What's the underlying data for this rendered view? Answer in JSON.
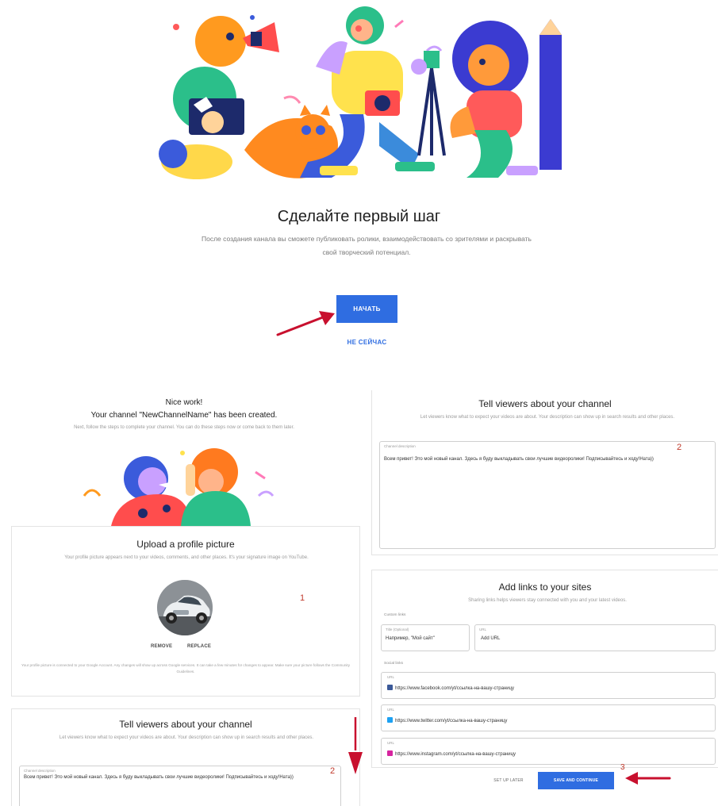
{
  "welcome": {
    "title": "Сделайте первый шаг",
    "description": "После создания канала вы сможете публиковать ролики, взаимодействовать со зрителями и раскрывать свой творческий потенциал.",
    "start_button": "НАЧАТЬ",
    "not_now_link": "НЕ СЕЙЧАС"
  },
  "created": {
    "line1": "Nice work!",
    "line2": "Your channel \"NewChannelName\" has been created.",
    "subtitle": "Next, follow the steps to complete your channel. You can do these steps now or come back to them later."
  },
  "profile_card": {
    "title": "Upload a profile picture",
    "description": "Your profile picture appears next to your videos, comments, and other places. It's your signature image on YouTube.",
    "remove_label": "REMOVE",
    "replace_label": "REPLACE",
    "note": "Your profile picture is connected to your Google Account. Any changes will show up across Google services. It can take a few minutes for changes to appear. Make sure your picture follows the Community Guidelines.",
    "step_number": "1"
  },
  "description_card": {
    "title": "Tell viewers about your channel",
    "subtitle": "Let viewers know what to expect your videos are about. Your description can show up in search results and other places.",
    "field_label": "Channel description",
    "field_value": "Всем привет! Это мой новый канал. Здесь я буду выкладывать свои лучшие видеоролики! Подписывайтесь и ходу!Ната))",
    "step_number": "2"
  },
  "links_card": {
    "title": "Add links to your sites",
    "subtitle": "Sharing links helps viewers stay connected with you and your latest videos.",
    "custom_label": "Custom links",
    "social_label": "Social links",
    "custom_title_label": "Title (Optional)",
    "custom_title_value": "Например, \"Мой сайт\"",
    "custom_url_label": "URL",
    "custom_url_value": "Add URL",
    "url_label": "URL",
    "facebook_url": "https://www.facebook.com/yt/ссылка-на-вашу-страницу",
    "twitter_url": "https://www.twitter.com/yt/ссылка-на-вашу-страницу",
    "instagram_url": "https://www.instagram.com/yt/ссылка-на-вашу-страницу"
  },
  "footer": {
    "later_label": "SET UP LATER",
    "save_label": "SAVE AND CONTINUE",
    "step_number": "3"
  },
  "icons": {
    "facebook": "facebook-icon",
    "twitter": "twitter-icon",
    "instagram": "instagram-icon",
    "arrow": "red-arrow-icon"
  },
  "colors": {
    "primary": "#2f6de1",
    "annotation": "#c8102e"
  }
}
